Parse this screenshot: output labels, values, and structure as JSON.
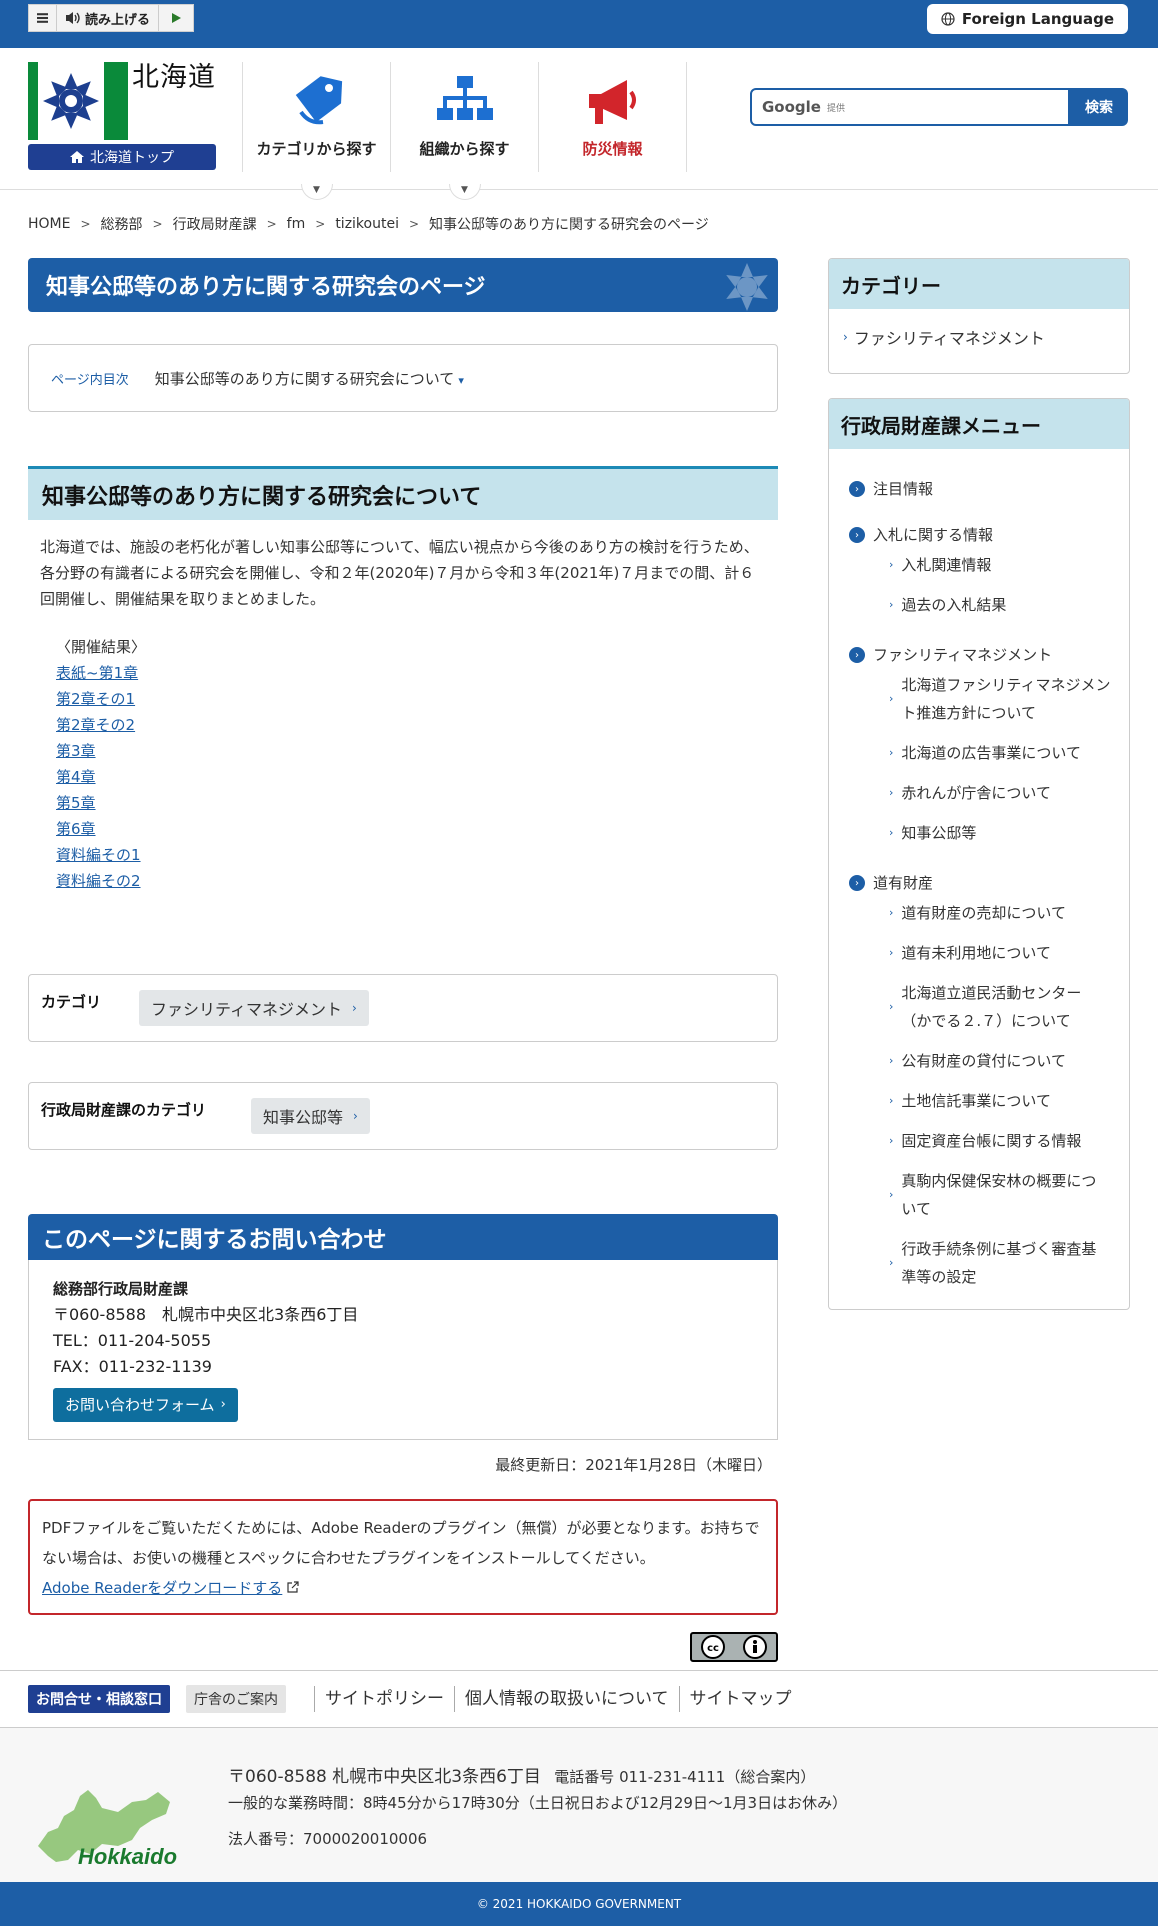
{
  "toolbar": {
    "read_aloud": "読み上げる",
    "foreign_language": "Foreign Language"
  },
  "header": {
    "logo_title": "北海道",
    "top_link": "北海道トップ",
    "nav": [
      {
        "label": "カテゴリから探す"
      },
      {
        "label": "組織から探す"
      },
      {
        "label": "防災情報"
      }
    ],
    "search": {
      "google": "Google",
      "provided": "提供",
      "button": "検索"
    }
  },
  "breadcrumb": [
    "HOME",
    "総務部",
    "行政局財産課",
    "fm",
    "tizikoutei",
    "知事公邸等のあり方に関する研究会のページ"
  ],
  "main": {
    "page_title": "知事公邸等のあり方に関する研究会のページ",
    "toc_label": "ページ内目次",
    "toc_link": "知事公邸等のあり方に関する研究会について",
    "section_title": "知事公邸等のあり方に関する研究会について",
    "intro": "北海道では、施設の老朽化が著しい知事公邸等について、幅広い視点から今後のあり方の検討を行うため、各分野の有識者による研究会を開催し、令和２年(2020年)７月から令和３年(2021年)７月までの間、計６回開催し、開催結果を取りまとめました。",
    "results_label": "〈開催結果〉",
    "results": [
      "表紙~第1章",
      "第2章その1",
      "第2章その2",
      "第3章",
      "第4章",
      "第5章",
      "第6章",
      "資料編その1",
      "資料編その2"
    ],
    "category_label": "カテゴリ",
    "category_tag": "ファシリティマネジメント",
    "dept_category_label": "行政局財産課のカテゴリ",
    "dept_category_tag": "知事公邸等",
    "contact": {
      "title": "このページに関するお問い合わせ",
      "org": "総務部行政局財産課",
      "address": "〒060-8588　札幌市中央区北3条西6丁目",
      "tel": "TEL：011-204-5055",
      "fax": "FAX：011-232-1139",
      "form_button": "お問い合わせフォーム"
    },
    "updated": "最終更新日：2021年1月28日（木曜日）",
    "pdf_notice": "PDFファイルをご覧いただくためには、Adobe Readerのプラグイン（無償）が必要となります。お持ちでない場合は、お使いの機種とスペックに合わせたプラグインをインストールしてください。",
    "pdf_link": "Adobe Readerをダウンロードする"
  },
  "sidebar": {
    "category_title": "カテゴリー",
    "category_item": "ファシリティマネジメント",
    "menu_title": "行政局財産課メニュー",
    "menu": [
      {
        "label": "注目情報",
        "subs": []
      },
      {
        "label": "入札に関する情報",
        "subs": [
          "入札関連情報",
          "過去の入札結果"
        ]
      },
      {
        "label": "ファシリティマネジメント",
        "subs": [
          "北海道ファシリティマネジメント推進方針について",
          "北海道の広告事業について",
          "赤れんが庁舎について",
          "知事公邸等"
        ]
      },
      {
        "label": "道有財産",
        "subs": [
          "道有財産の売却について",
          "道有未利用地について",
          "北海道立道民活動センター（かでる２.７）について",
          "公有財産の貸付について",
          "土地信託事業について",
          "固定資産台帳に関する情報",
          "真駒内保健保安林の概要について",
          "行政手続条例に基づく審査基準等の設定"
        ]
      }
    ]
  },
  "footer": {
    "contact_window": "お問合せ・相談窓口",
    "office_guide": "庁舎のご案内",
    "links": [
      "サイトポリシー",
      "個人情報の取扱いについて",
      "サイトマップ"
    ],
    "address": "〒060-8588 札幌市中央区北3条西6丁目",
    "phone": "電話番号 011-231-4111（総合案内）",
    "hours": "一般的な業務時間：8時45分から17時30分（土日祝日および12月29日～1月3日はお休み）",
    "corp_number": "法人番号：7000020010006",
    "logo_text": "Hokkaido",
    "copyright": "© 2021 HOKKAIDO GOVERNMENT"
  },
  "colors": {
    "primary": "#1d5ea6",
    "accent_light": "#c5e3ec",
    "alert": "#c3262b"
  }
}
